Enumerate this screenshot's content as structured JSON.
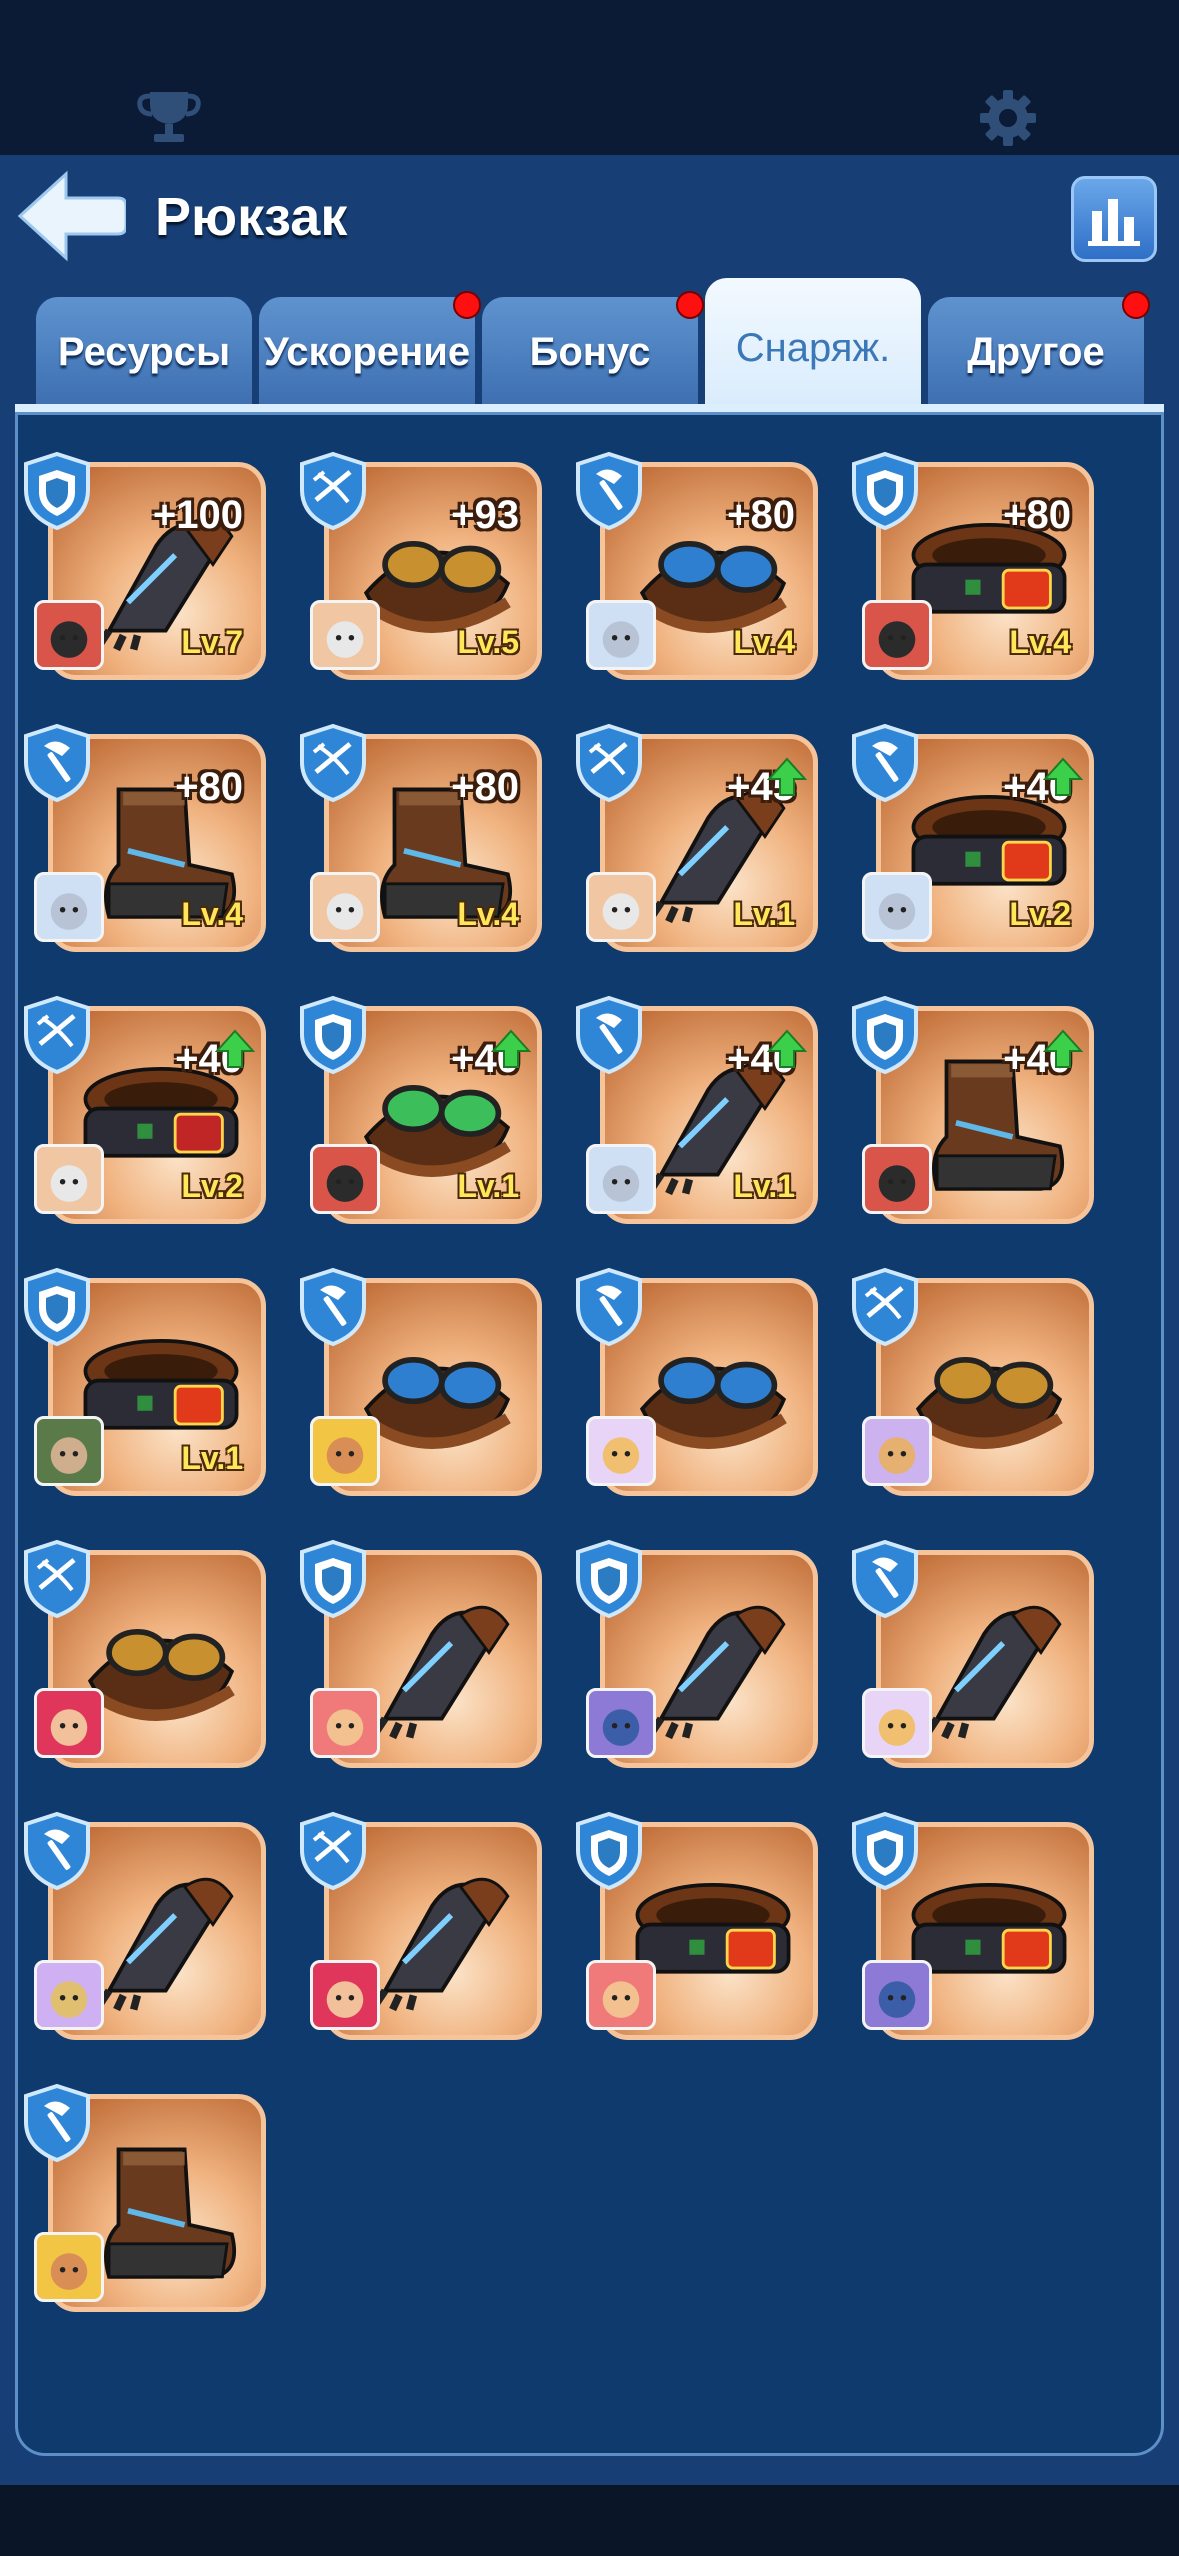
{
  "header": {
    "title": "Рюкзак"
  },
  "tabs": [
    {
      "label": "Ресурсы",
      "dot": false,
      "active": false
    },
    {
      "label": "Ускорение",
      "dot": true,
      "active": false
    },
    {
      "label": "Бонус",
      "dot": true,
      "active": false
    },
    {
      "label": "Снаряж.",
      "dot": false,
      "active": true
    },
    {
      "label": "Другое",
      "dot": true,
      "active": false
    }
  ],
  "items": [
    {
      "slot": "shield",
      "gear": "gauntlet",
      "bonus": "+100",
      "level": "Lv.7",
      "up": false,
      "hero": "red-knight"
    },
    {
      "slot": "crossbow",
      "gear": "goggles",
      "bonus": "+93",
      "level": "Lv.5",
      "up": false,
      "hero": "old-man"
    },
    {
      "slot": "axe",
      "gear": "goggles-blue",
      "bonus": "+80",
      "level": "Lv.4",
      "up": false,
      "hero": "girl"
    },
    {
      "slot": "shield",
      "gear": "belt",
      "bonus": "+80",
      "level": "Lv.4",
      "up": false,
      "hero": "red-knight"
    },
    {
      "slot": "axe",
      "gear": "boot",
      "bonus": "+80",
      "level": "Lv.4",
      "up": false,
      "hero": "girl"
    },
    {
      "slot": "crossbow",
      "gear": "boot-dark",
      "bonus": "+80",
      "level": "Lv.4",
      "up": false,
      "hero": "old-man"
    },
    {
      "slot": "crossbow",
      "gear": "gauntlet",
      "bonus": "+45",
      "level": "Lv.1",
      "up": true,
      "hero": "old-man"
    },
    {
      "slot": "axe",
      "gear": "belt-red",
      "bonus": "+40",
      "level": "Lv.2",
      "up": true,
      "hero": "girl"
    },
    {
      "slot": "crossbow",
      "gear": "belt-triangle",
      "bonus": "+40",
      "level": "Lv.2",
      "up": true,
      "hero": "old-man"
    },
    {
      "slot": "shield",
      "gear": "goggles-green",
      "bonus": "+40",
      "level": "Lv.1",
      "up": true,
      "hero": "red-knight"
    },
    {
      "slot": "axe",
      "gear": "gauntlet",
      "bonus": "+40",
      "level": "Lv.1",
      "up": true,
      "hero": "girl"
    },
    {
      "slot": "shield",
      "gear": "boot-dark",
      "bonus": "+40",
      "level": "",
      "up": true,
      "hero": "red-knight"
    },
    {
      "slot": "shield",
      "gear": "belt",
      "bonus": "",
      "level": "Lv.1",
      "up": false,
      "hero": "green-helmet"
    },
    {
      "slot": "axe",
      "gear": "goggles-blue",
      "bonus": "",
      "level": "",
      "up": false,
      "hero": "miner"
    },
    {
      "slot": "axe",
      "gear": "goggles-blue",
      "bonus": "",
      "level": "",
      "up": false,
      "hero": "chef"
    },
    {
      "slot": "crossbow",
      "gear": "goggles",
      "bonus": "",
      "level": "",
      "up": false,
      "hero": "pilot"
    },
    {
      "slot": "crossbow",
      "gear": "goggles",
      "bonus": "",
      "level": "",
      "up": false,
      "hero": "redhead"
    },
    {
      "slot": "shield",
      "gear": "gauntlet",
      "bonus": "",
      "level": "",
      "up": false,
      "hero": "beret"
    },
    {
      "slot": "shield",
      "gear": "gauntlet",
      "bonus": "",
      "level": "",
      "up": false,
      "hero": "soldier"
    },
    {
      "slot": "axe",
      "gear": "gauntlet",
      "bonus": "",
      "level": "",
      "up": false,
      "hero": "chef"
    },
    {
      "slot": "axe",
      "gear": "gauntlet",
      "bonus": "",
      "level": "",
      "up": false,
      "hero": "viking"
    },
    {
      "slot": "crossbow",
      "gear": "gauntlet",
      "bonus": "",
      "level": "",
      "up": false,
      "hero": "redhead"
    },
    {
      "slot": "shield",
      "gear": "belt",
      "bonus": "",
      "level": "",
      "up": false,
      "hero": "beret"
    },
    {
      "slot": "shield",
      "gear": "belt",
      "bonus": "",
      "level": "",
      "up": false,
      "hero": "soldier"
    },
    {
      "slot": "axe",
      "gear": "boot",
      "bonus": "",
      "level": "",
      "up": false,
      "hero": "miner"
    }
  ],
  "icons": {
    "trophy": "trophy-icon",
    "settings": "gear-icon",
    "back": "back-arrow-icon",
    "stats": "bar-chart-icon"
  },
  "colors": {
    "bg": "#173f75",
    "panel": "#0f3a6e",
    "tab": "#4f84c4",
    "active_tab": "#e8f4fe",
    "level": "#ffe65a",
    "dot": "#ff1010"
  }
}
